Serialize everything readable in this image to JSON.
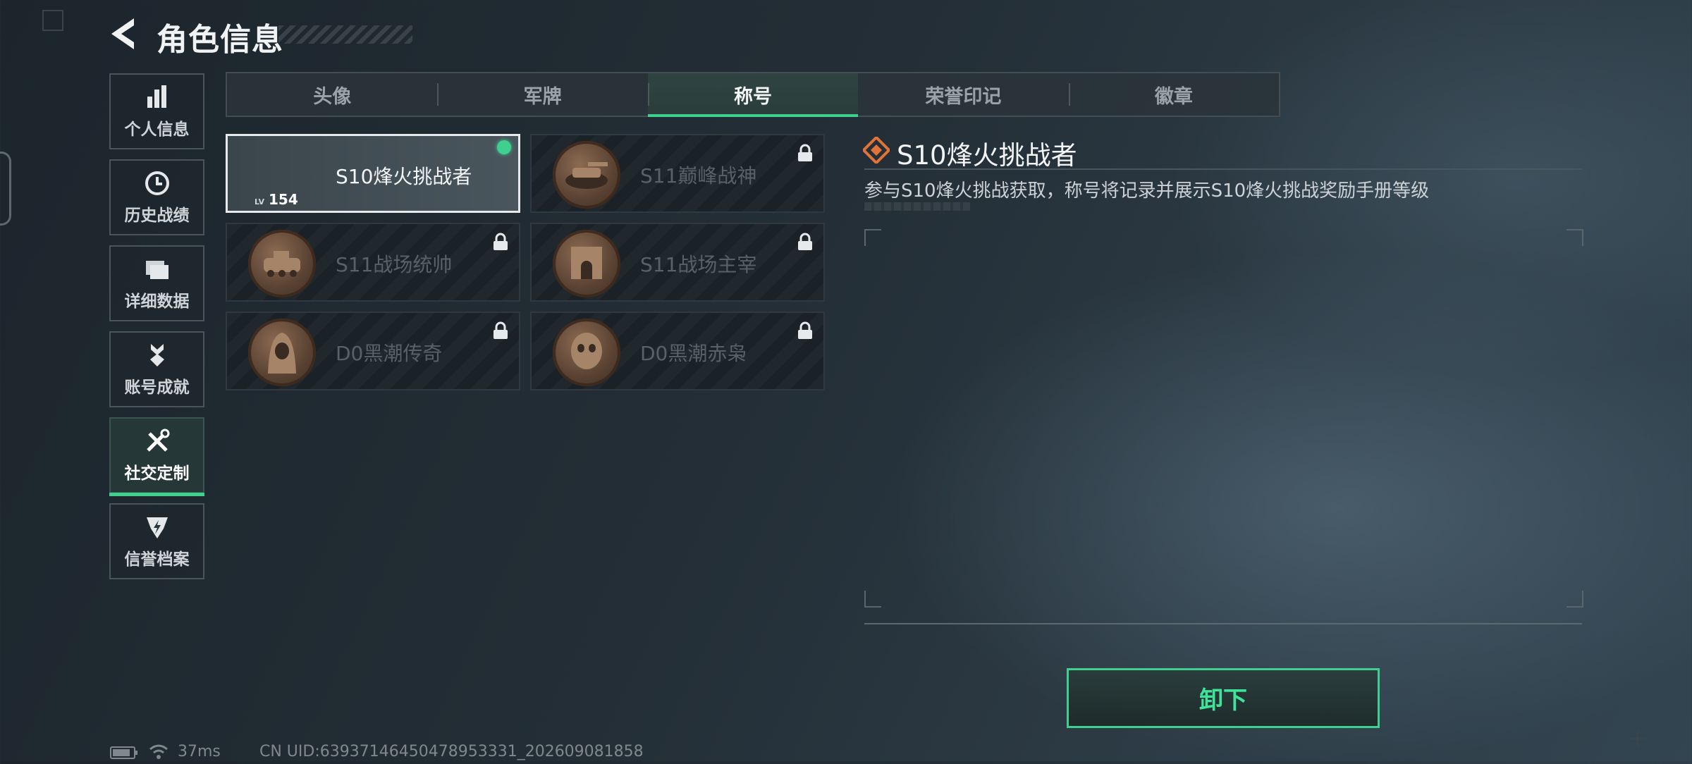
{
  "header": {
    "title": "角色信息"
  },
  "sidebar": {
    "items": [
      {
        "label": "个人信息"
      },
      {
        "label": "历史战绩"
      },
      {
        "label": "详细数据"
      },
      {
        "label": "账号成就"
      },
      {
        "label": "社交定制"
      },
      {
        "label": "信誉档案"
      }
    ],
    "active_index": 4
  },
  "tabs": [
    {
      "label": "头像"
    },
    {
      "label": "军牌"
    },
    {
      "label": "称号"
    },
    {
      "label": "荣誉印记"
    },
    {
      "label": "徽章"
    }
  ],
  "active_tab": "称号",
  "cards": [
    {
      "title": "S10烽火挑战者",
      "level_prefix": "LV",
      "level": "154",
      "selected": true,
      "locked": false
    },
    {
      "title": "S11巅峰战神",
      "selected": false,
      "locked": true
    },
    {
      "title": "S11战场统帅",
      "selected": false,
      "locked": true
    },
    {
      "title": "S11战场主宰",
      "selected": false,
      "locked": true
    },
    {
      "title": "D0黑潮传奇",
      "selected": false,
      "locked": true
    },
    {
      "title": "D0黑潮赤枭",
      "selected": false,
      "locked": true
    }
  ],
  "detail": {
    "title": "S10烽火挑战者",
    "description": "参与S10烽火挑战获取，称号将记录并展示S10烽火挑战奖励手册等级"
  },
  "actions": {
    "unequip_label": "卸下"
  },
  "status_bar": {
    "ping": "37ms",
    "uid": "CN UID:63937146450478953331_202609081858"
  },
  "colors": {
    "accent_green": "#3fcf8e",
    "detail_icon_orange": "#e0733a",
    "medal_bronze": "#8b6a52"
  }
}
